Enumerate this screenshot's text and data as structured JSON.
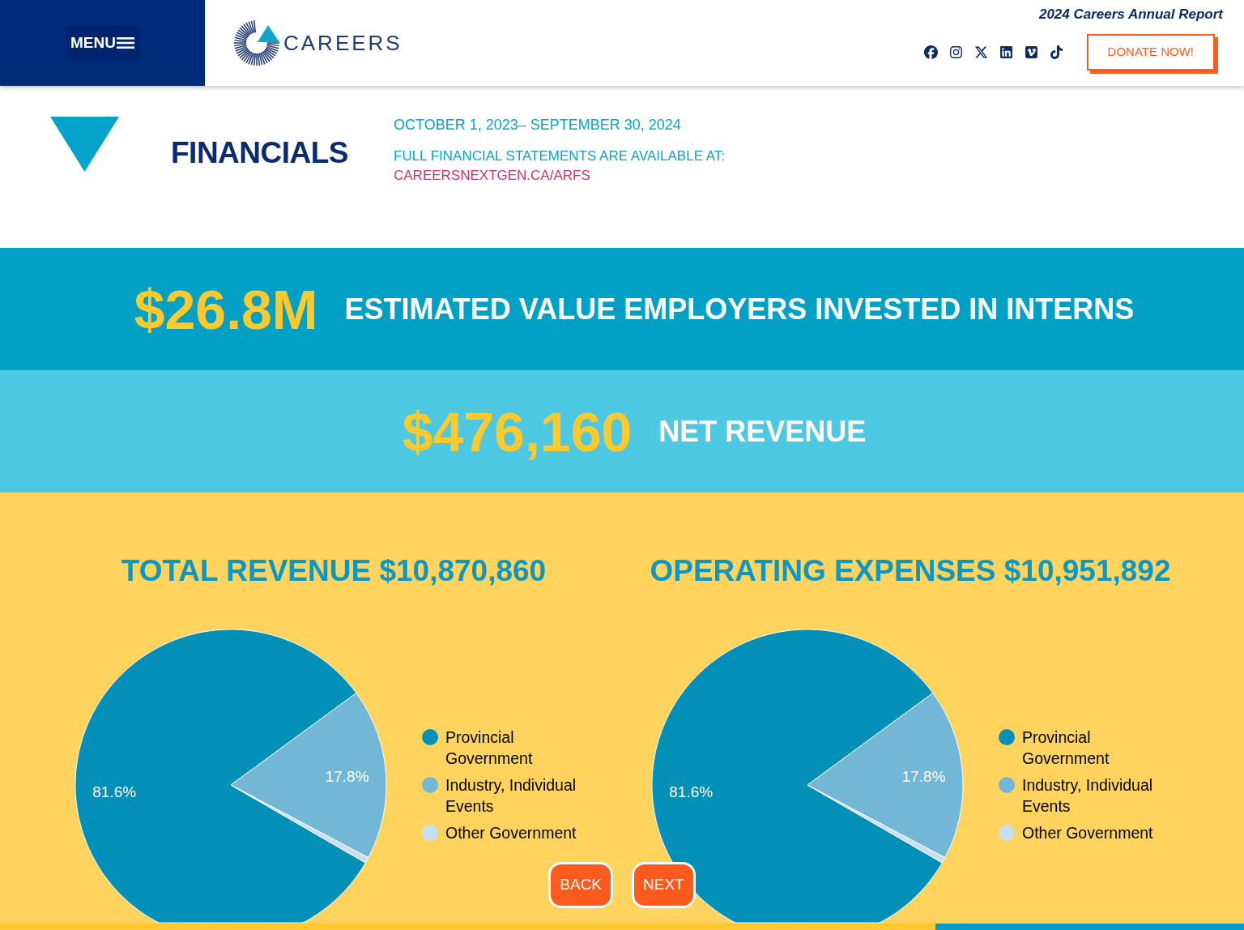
{
  "header": {
    "menu_button": "MENU",
    "logo_text": "CAREERS",
    "report_title": "2024 Careers Annual Report",
    "donate_button": "DONATE NOW!"
  },
  "intro": {
    "title": "FINANCIALS",
    "period": "OCTOBER 1, 2023– SEPTEMBER 30, 2024",
    "statement_note": "FULL FINANCIAL STATEMENTS ARE AVAILABLE AT:",
    "statement_link": "CAREERSNEXTGEN.CA/ARFS"
  },
  "highlights": [
    {
      "amount": "$26.8M",
      "label": "ESTIMATED VALUE EMPLOYERS INVESTED IN INTERNS",
      "color": "#03a0c6"
    },
    {
      "amount": "$476,160",
      "label": "NET REVENUE",
      "color": "#4cc8e2"
    }
  ],
  "charts": [
    {
      "chart_data": {
        "type": "pie",
        "title": "TOTAL REVENUE $10,870,860",
        "categories": [
          "Provincial Government",
          "Industry, Individual Events",
          "Other Government"
        ],
        "values": [
          81.6,
          17.8,
          0.6
        ],
        "colors": [
          "#0290b8",
          "#73b7d6",
          "#c6e0f0"
        ],
        "value_labels": [
          "81.6%",
          "17.8%",
          null
        ],
        "legend": "right"
      }
    },
    {
      "chart_data": {
        "type": "pie",
        "title": "OPERATING EXPENSES $10,951,892",
        "categories": [
          "Provincial Government",
          "Industry, Individual Events",
          "Other Government"
        ],
        "values": [
          81.6,
          17.8,
          0.6
        ],
        "colors": [
          "#0290b8",
          "#73b7d6",
          "#c6e0f0"
        ],
        "value_labels": [
          "81.6%",
          "17.8%",
          null
        ],
        "legend": "right"
      }
    }
  ],
  "navigation": {
    "back": "BACK",
    "next": "NEXT"
  },
  "page_progress": {
    "level": 0.752
  }
}
